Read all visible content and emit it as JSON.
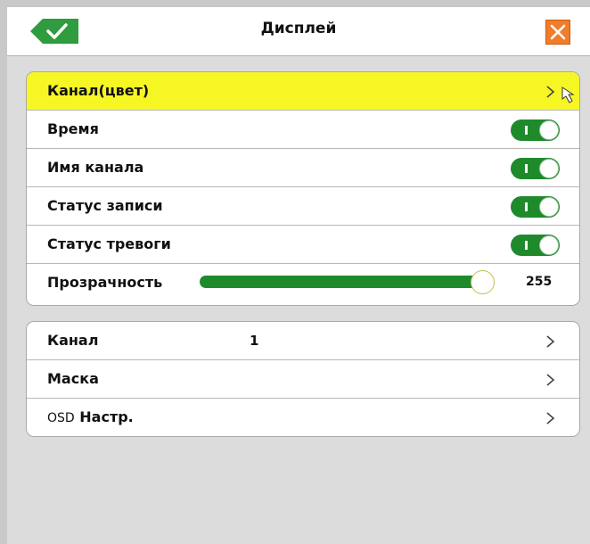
{
  "window": {
    "title": "Дисплей",
    "ok_icon": "check-icon",
    "close_icon": "close-icon",
    "ok_color": "#2e9c3f",
    "close_color": "#f07d2b"
  },
  "display_group": {
    "rows": [
      {
        "label": "Канал(цвет)",
        "type": "submenu",
        "selected": true
      },
      {
        "label": "Время",
        "type": "toggle",
        "on": true
      },
      {
        "label": "Имя канала",
        "type": "toggle",
        "on": true
      },
      {
        "label": "Статус записи",
        "type": "toggle",
        "on": true
      },
      {
        "label": "Статус тревоги",
        "type": "toggle",
        "on": true
      },
      {
        "label": "Прозрачность",
        "type": "slider",
        "value": 255,
        "max": 255
      }
    ]
  },
  "settings_group": {
    "rows": [
      {
        "label": "Канал",
        "value": "1",
        "type": "submenu"
      },
      {
        "label": "Маска",
        "type": "submenu"
      },
      {
        "label_prefix": "OSD",
        "label": "Настр.",
        "type": "submenu"
      }
    ]
  },
  "colors": {
    "highlight": "#f6f625",
    "toggle_on": "#1f8a2c"
  }
}
